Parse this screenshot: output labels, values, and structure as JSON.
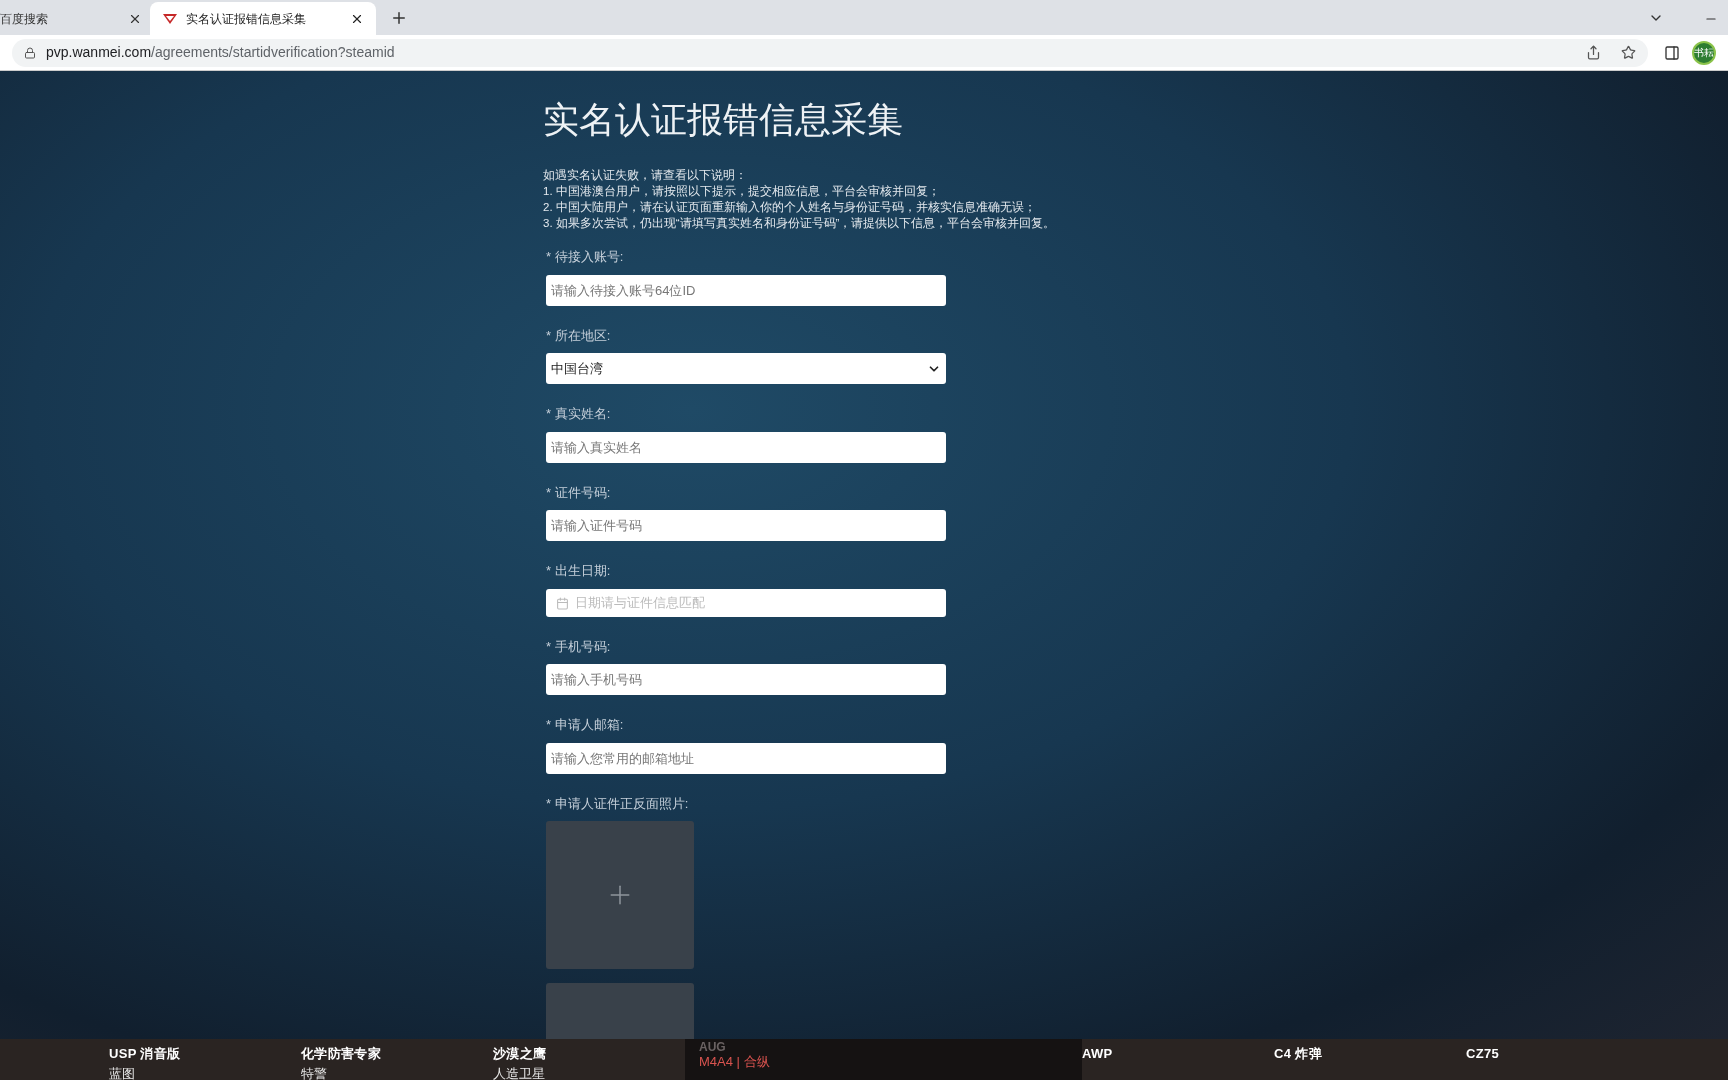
{
  "browser": {
    "tabs": [
      {
        "title": "百度搜索",
        "selected": false
      },
      {
        "title": "实名认证报错信息采集",
        "selected": true
      }
    ],
    "url_host": "pvp.wanmei.com",
    "url_path": "/agreements/startidverification?steamid",
    "profile": "书耘"
  },
  "page": {
    "title": "实名认证报错信息采集",
    "notes": [
      "如遇实名认证失败，请查看以下说明：",
      "1. 中国港澳台用户，请按照以下提示，提交相应信息，平台会审核并回复；",
      "2. 中国大陆用户，请在认证页面重新输入你的个人姓名与身份证号码，并核实信息准确无误；",
      "3. 如果多次尝试，仍出现“请填写真实姓名和身份证号码”，请提供以下信息，平台会审核并回复。"
    ],
    "fields": [
      {
        "kind": "text",
        "label": "* 待接入账号:",
        "placeholder": "请输入待接入账号64位ID"
      },
      {
        "kind": "select",
        "label": "* 所在地区:",
        "value": "中国台湾"
      },
      {
        "kind": "text",
        "label": "* 真实姓名:",
        "placeholder": "请输入真实姓名"
      },
      {
        "kind": "text",
        "label": "* 证件号码:",
        "placeholder": "请输入证件号码"
      },
      {
        "kind": "date",
        "label": "* 出生日期:",
        "placeholder": "日期请与证件信息匹配"
      },
      {
        "kind": "text",
        "label": "* 手机号码:",
        "placeholder": "请输入手机号码"
      },
      {
        "kind": "text",
        "label": "* 申请人邮箱:",
        "placeholder": "请输入您常用的邮箱地址"
      },
      {
        "kind": "upload",
        "label": "* 申请人证件正反面照片:"
      }
    ]
  },
  "overlay": [
    {
      "kind": "item",
      "name": "USP 消音版",
      "sub": "蓝图"
    },
    {
      "kind": "item",
      "name": "化学防害专家",
      "sub": "特警"
    },
    {
      "kind": "item",
      "name": "沙漠之鹰",
      "sub": "人造卫星"
    },
    {
      "kind": "panel",
      "name": "M4A4 | 合纵",
      "sub": "AUG"
    },
    {
      "kind": "item",
      "name": "AWP"
    },
    {
      "kind": "item",
      "name": "C4 炸弹"
    },
    {
      "kind": "item",
      "name": "CZ75"
    }
  ]
}
